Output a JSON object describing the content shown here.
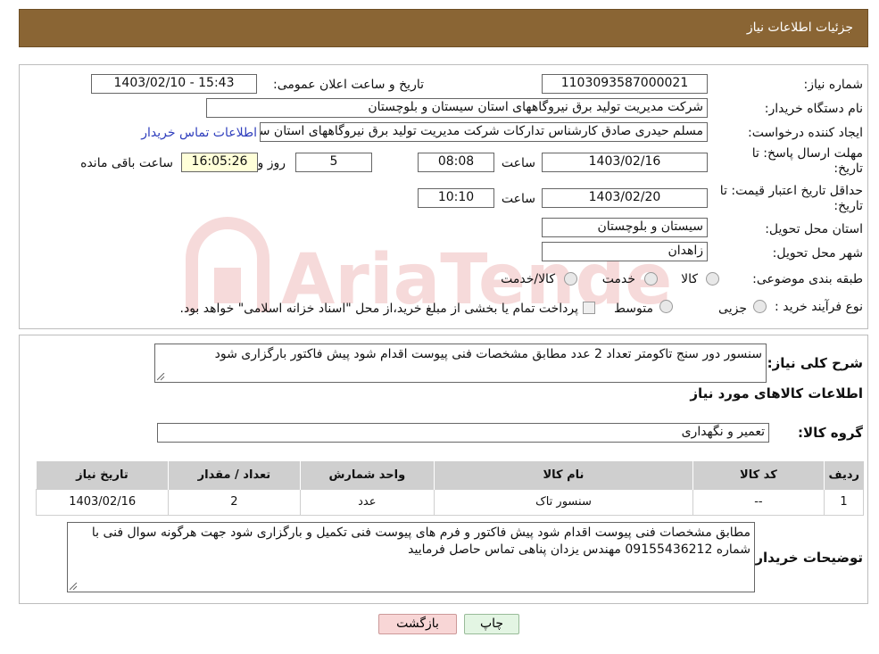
{
  "header": {
    "title": "جزئیات اطلاعات نیاز"
  },
  "watermark": {
    "text": "AriaTender.neT"
  },
  "form": {
    "need_number_label": "شماره نیاز:",
    "need_number": "1103093587000021",
    "announce_label": "تاریخ و ساعت اعلان عمومی:",
    "announce_value": "1403/02/10 - 15:43",
    "buyer_org_label": "نام دستگاه خریدار:",
    "buyer_org": "شرکت مدیریت تولید برق نیروگاههای استان سیستان و بلوچستان",
    "creator_label": "ایجاد کننده درخواست:",
    "creator": "مسلم حیدری صادق کارشناس تدارکات شرکت مدیریت تولید برق نیروگاههای استان سیستان و بلوچستان",
    "contact_link": "اطلاعات تماس خریدار",
    "deadline_label": "مهلت ارسال پاسخ: تا تاریخ:",
    "deadline_date": "1403/02/16",
    "time_label": "ساعت",
    "deadline_time": "08:08",
    "days_value": "5",
    "days_label": "روز و",
    "remaining_time": "16:05:26",
    "remaining_label": "ساعت باقی مانده",
    "validity_label": "حداقل تاریخ اعتبار قیمت: تا تاریخ:",
    "validity_date": "1403/02/20",
    "validity_time": "10:10",
    "province_label": "استان محل تحویل:",
    "province": "سیستان و بلوچستان",
    "city_label": "شهر محل تحویل:",
    "city": "زاهدان",
    "category_label": "طبقه بندی موضوعی:",
    "category_options": [
      "کالا",
      "خدمت",
      "کالا/خدمت"
    ],
    "process_label": "نوع فرآیند خرید :",
    "process_options": [
      "جزیی",
      "متوسط"
    ],
    "payment_note": "پرداخت تمام یا بخشی از مبلغ خرید،از محل \"اسناد خزانه اسلامی\" خواهد بود."
  },
  "details": {
    "summary_label": "شرح کلی نیاز:",
    "summary": "سنسور دور سنج تاکومتر تعداد 2 عدد مطابق مشخصات فنی پیوست اقدام شود پیش فاکتور بارگزاری شود",
    "items_title": "اطلاعات کالاهای مورد نیاز",
    "group_label": "گروه کالا:",
    "group_value": "تعمیر و نگهداری",
    "table": {
      "headers": [
        "ردیف",
        "کد کالا",
        "نام کالا",
        "واحد شمارش",
        "تعداد / مقدار",
        "تاریخ نیاز"
      ],
      "rows": [
        [
          "1",
          "--",
          "سنسور تاک",
          "عدد",
          "2",
          "1403/02/16"
        ]
      ]
    },
    "buyer_notes_label": "توضیحات خریدار:",
    "buyer_notes": "مطابق مشخصات فنی پیوست اقدام شود  پیش فاکتور و فرم های پیوست فنی تکمیل و بارگزاری شود  جهت هرگونه سوال فنی با شماره 09155436212 مهندس یزدان پناهی تماس حاصل فرمایید"
  },
  "buttons": {
    "back": "بازگشت",
    "print": "چاپ"
  }
}
